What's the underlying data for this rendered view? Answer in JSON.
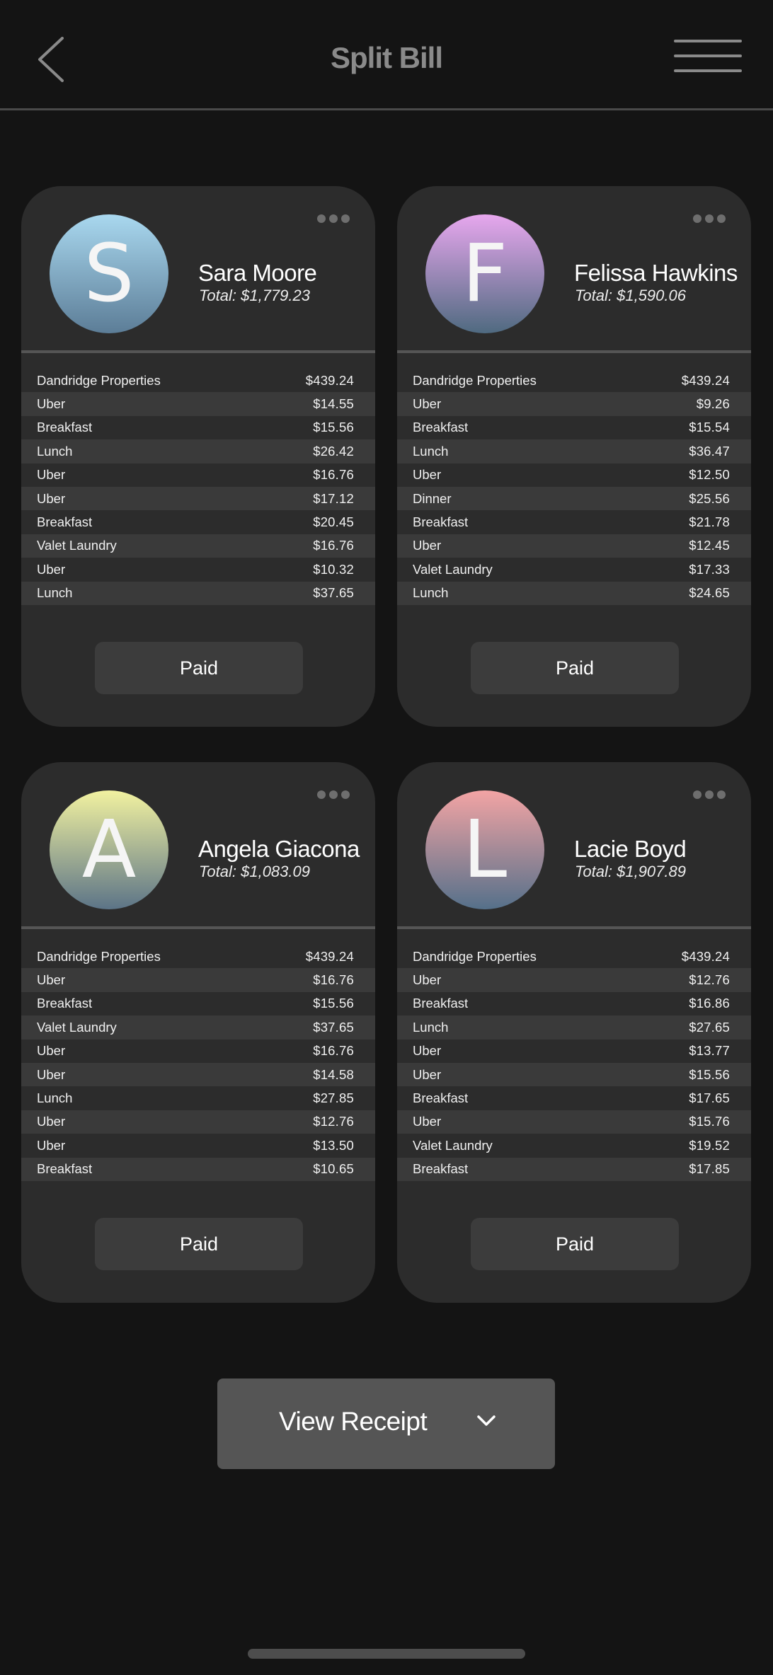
{
  "header": {
    "title": "Split Bill",
    "back_icon": "chevron-left-icon",
    "menu_icon": "hamburger-menu-icon"
  },
  "cards": [
    {
      "initial": "S",
      "name": "Sara Moore",
      "total": "Total: $1,779.23",
      "avatar_colors": [
        "#a9d8ef",
        "#5c7d97"
      ],
      "items": [
        {
          "label": "Dandridge Properties",
          "amount": "$439.24"
        },
        {
          "label": "Uber",
          "amount": "$14.55"
        },
        {
          "label": "Breakfast",
          "amount": "$15.56"
        },
        {
          "label": "Lunch",
          "amount": "$26.42"
        },
        {
          "label": "Uber",
          "amount": "$16.76"
        },
        {
          "label": "Uber",
          "amount": "$17.12"
        },
        {
          "label": "Breakfast",
          "amount": "$20.45"
        },
        {
          "label": "Valet Laundry",
          "amount": "$16.76"
        },
        {
          "label": "Uber",
          "amount": "$10.32"
        },
        {
          "label": "Lunch",
          "amount": "$37.65"
        }
      ],
      "button": "Paid"
    },
    {
      "initial": "F",
      "name": "Felissa Hawkins",
      "total": "Total: $1,590.06",
      "avatar_colors": [
        "#e7a7ee",
        "#4f6a80"
      ],
      "items": [
        {
          "label": "Dandridge Properties",
          "amount": "$439.24"
        },
        {
          "label": "Uber",
          "amount": "$9.26"
        },
        {
          "label": "Breakfast",
          "amount": "$15.54"
        },
        {
          "label": "Lunch",
          "amount": "$36.47"
        },
        {
          "label": "Uber",
          "amount": "$12.50"
        },
        {
          "label": "Dinner",
          "amount": "$25.56"
        },
        {
          "label": "Breakfast",
          "amount": "$21.78"
        },
        {
          "label": "Uber",
          "amount": "$12.45"
        },
        {
          "label": "Valet Laundry",
          "amount": "$17.33"
        },
        {
          "label": "Lunch",
          "amount": "$24.65"
        }
      ],
      "button": "Paid"
    },
    {
      "initial": "A",
      "name": "Angela Giacona",
      "total": "Total: $1,083.09",
      "avatar_colors": [
        "#f2f2a0",
        "#5c7487"
      ],
      "items": [
        {
          "label": "Dandridge Properties",
          "amount": "$439.24"
        },
        {
          "label": "Uber",
          "amount": "$16.76"
        },
        {
          "label": "Breakfast",
          "amount": "$15.56"
        },
        {
          "label": "Valet Laundry",
          "amount": "$37.65"
        },
        {
          "label": "Uber",
          "amount": "$16.76"
        },
        {
          "label": "Uber",
          "amount": "$14.58"
        },
        {
          "label": "Lunch",
          "amount": "$27.85"
        },
        {
          "label": "Uber",
          "amount": "$12.76"
        },
        {
          "label": "Uber",
          "amount": "$13.50"
        },
        {
          "label": "Breakfast",
          "amount": "$10.65"
        }
      ],
      "button": "Paid"
    },
    {
      "initial": "L",
      "name": "Lacie Boyd",
      "total": "Total: $1,907.89",
      "avatar_colors": [
        "#f3a4a4",
        "#55708a"
      ],
      "items": [
        {
          "label": "Dandridge Properties",
          "amount": "$439.24"
        },
        {
          "label": "Uber",
          "amount": "$12.76"
        },
        {
          "label": "Breakfast",
          "amount": "$16.86"
        },
        {
          "label": "Lunch",
          "amount": "$27.65"
        },
        {
          "label": "Uber",
          "amount": "$13.77"
        },
        {
          "label": "Uber",
          "amount": "$15.56"
        },
        {
          "label": "Breakfast",
          "amount": "$17.65"
        },
        {
          "label": "Uber",
          "amount": "$15.76"
        },
        {
          "label": "Valet Laundry",
          "amount": "$19.52"
        },
        {
          "label": "Breakfast",
          "amount": "$17.85"
        }
      ],
      "button": "Paid"
    }
  ],
  "view_receipt": {
    "label": "View Receipt",
    "icon": "chevron-down-icon"
  }
}
